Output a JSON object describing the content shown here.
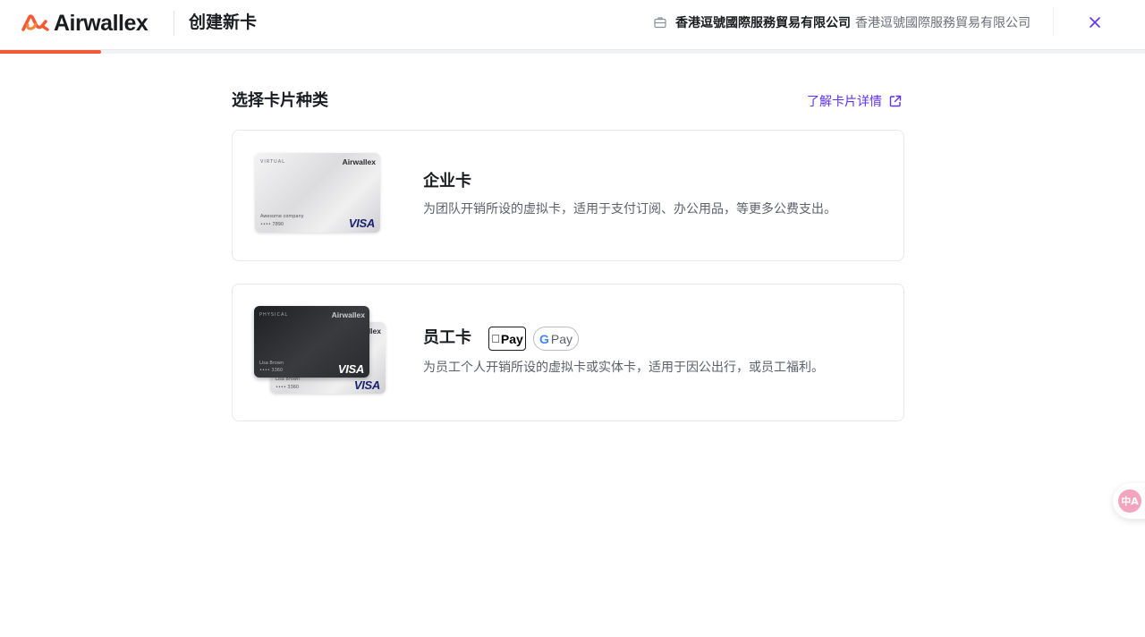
{
  "header": {
    "brand": "Airwallex",
    "title": "创建新卡",
    "company_name": "香港逗號國際服務貿易有限公司",
    "company_sub": "香港逗號國際服務貿易有限公司",
    "accent_color": "#f25a35"
  },
  "progress": {
    "fraction": 0.088
  },
  "main": {
    "section_title": "选择卡片种类",
    "learn_link": "了解卡片详情",
    "options": [
      {
        "title": "企业卡",
        "description": "为团队开销所设的虚拟卡，适用于支付订阅、办公用品，等更多公费支出。",
        "card_art": {
          "type_label": "VIRTUAL",
          "brand": "Airwallex",
          "holder": "Awesome company",
          "number": "•••• 7890",
          "network": "VISA"
        }
      },
      {
        "title": "员工卡",
        "description": "为员工个人开销所设的虚拟卡或实体卡，适用于因公出行，或员工福利。",
        "badges": {
          "apple_pay": "Pay",
          "google_pay_g": "G",
          "google_pay": "Pay"
        },
        "card_art": {
          "type_label": "PHYSICAL",
          "brand": "Airwallex",
          "holder": "Lisa Brown",
          "number": "•••• 3360",
          "network": "VISA"
        }
      }
    ]
  },
  "icons": {
    "close": "close-icon",
    "briefcase": "briefcase-icon",
    "external": "external-link-icon",
    "translate": "translate-icon"
  },
  "translate_fab": {
    "label": "中A"
  }
}
